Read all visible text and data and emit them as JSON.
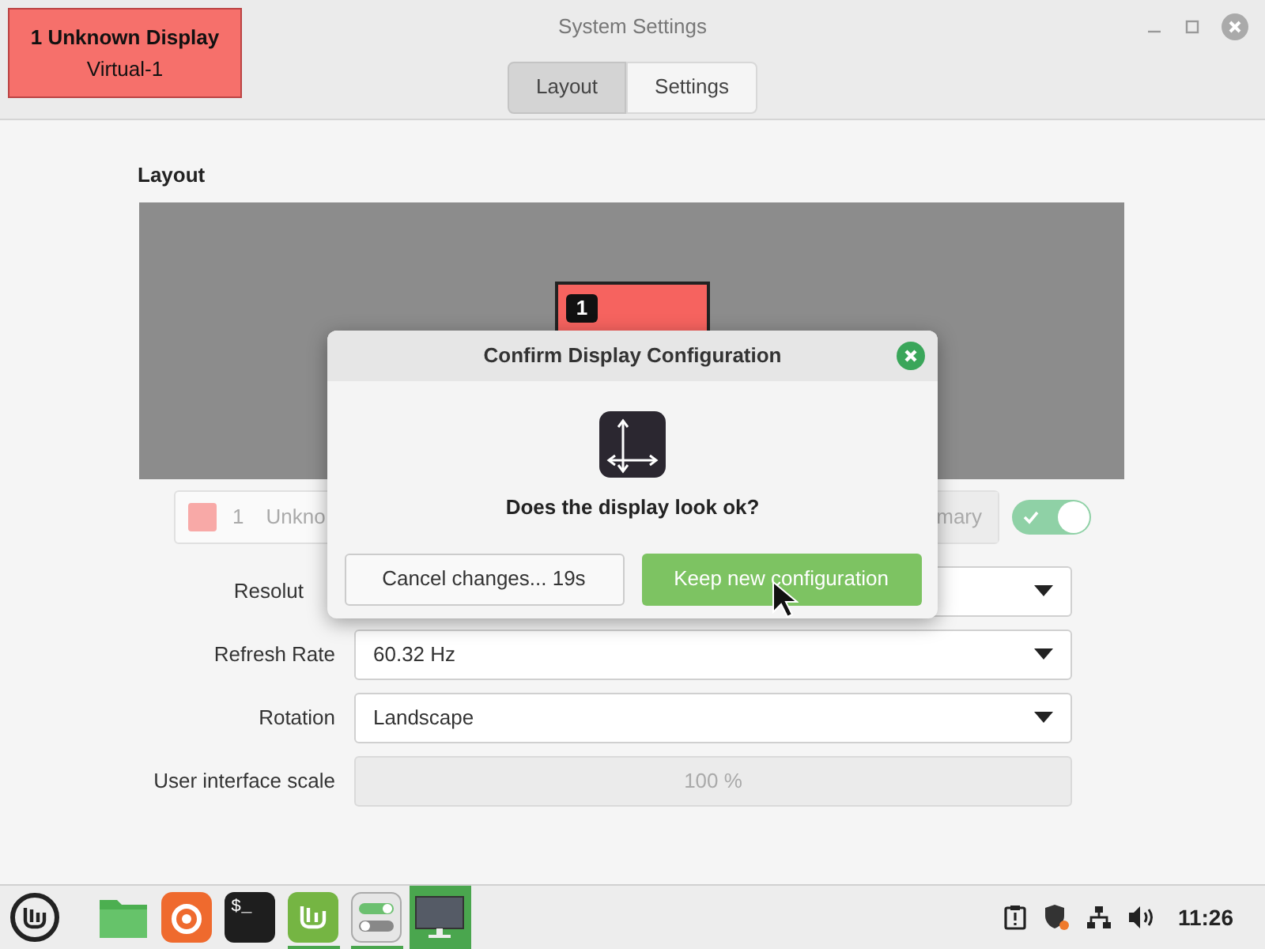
{
  "window": {
    "title": "System Settings"
  },
  "display_label": {
    "number": "1",
    "name": "Unknown Display",
    "output": "Virtual-1"
  },
  "tabs": [
    {
      "label": "Layout",
      "selected": true
    },
    {
      "label": "Settings",
      "selected": false
    }
  ],
  "layout": {
    "heading": "Layout",
    "monitor": {
      "number": "1"
    }
  },
  "monitor_row": {
    "number": "1",
    "name": "Unkno",
    "primary_label": "mary",
    "enabled": true
  },
  "settings": [
    {
      "label": "Resolut",
      "kind": "dropdown"
    },
    {
      "label": "Refresh Rate",
      "value": "60.32 Hz",
      "kind": "dropdown"
    },
    {
      "label": "Rotation",
      "value": "Landscape",
      "kind": "dropdown"
    },
    {
      "label": "User interface scale",
      "value": "100 %",
      "kind": "disabled"
    }
  ],
  "dialog": {
    "title": "Confirm Display Configuration",
    "question": "Does the display look ok?",
    "buttons": [
      {
        "label": "Cancel changes... 19s",
        "kind": "default"
      },
      {
        "label": "Keep new configuration",
        "kind": "suggested"
      }
    ]
  },
  "taskbar": {
    "items": [
      {
        "kind": "menu",
        "selected": false,
        "running": false
      },
      {
        "kind": "files",
        "selected": false,
        "running": false
      },
      {
        "kind": "browser",
        "selected": false,
        "running": false
      },
      {
        "kind": "terminal",
        "label": "$_",
        "selected": false,
        "running": false
      },
      {
        "kind": "mint",
        "selected": false,
        "running": true
      },
      {
        "kind": "settings",
        "selected": false,
        "running": true
      },
      {
        "kind": "display",
        "selected": true,
        "running": false
      }
    ],
    "clock": "11:26"
  }
}
